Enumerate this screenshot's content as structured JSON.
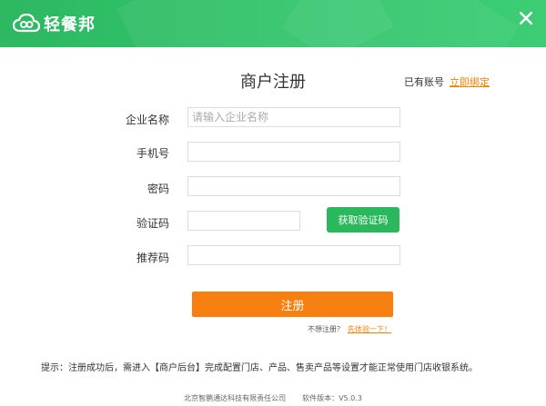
{
  "colors": {
    "header_green": "#31c36a",
    "accent_orange": "#f67f0f",
    "sms_button_green": "#2bb85d",
    "link_orange": "#f18100"
  },
  "header": {
    "logo_text": "轻餐邦",
    "logo_icon": "cloud-logo-icon",
    "close_icon": "close-icon"
  },
  "form": {
    "title": "商户注册",
    "has_account_text": "已有账号",
    "bind_link": "立即绑定",
    "company_label": "企业名称",
    "company_placeholder": "请输入企业名称",
    "phone_label": "手机号",
    "phone_value": "",
    "password_label": "密码",
    "password_value": "",
    "captcha_label": "验证码",
    "captcha_value": "",
    "sms_button": "获取验证码",
    "referrer_label": "推荐码",
    "referrer_value": "",
    "register_button": "注册",
    "skip_text": "不想注册？",
    "skip_link": "先体验一下！"
  },
  "tip": "提示：注册成功后，需进入【商户后台】完成配置门店、产品、售卖产品等设置才能正常使用门店收银系统。",
  "footer": {
    "company": "北京智鹏通达科技有限责任公司",
    "version": "软件版本：V5.0.3"
  }
}
